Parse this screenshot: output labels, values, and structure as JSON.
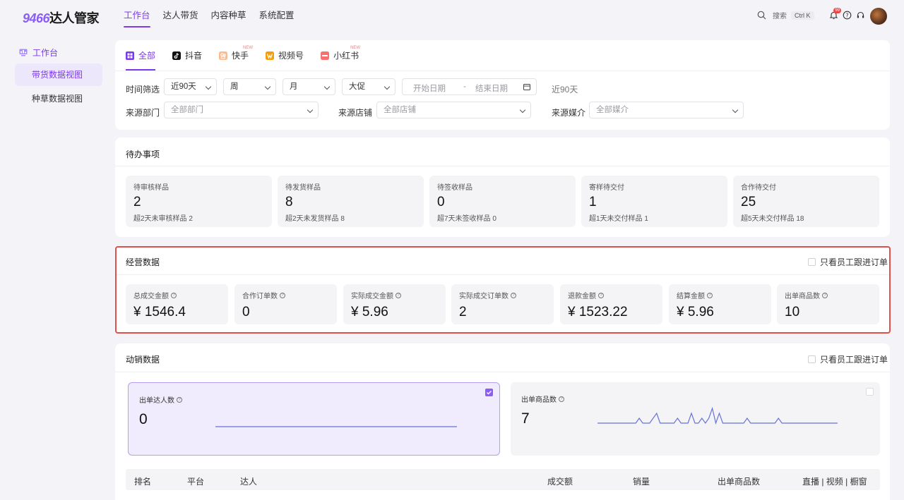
{
  "brand": {
    "num": "9466",
    "name": "达人管家"
  },
  "nav": [
    "工作台",
    "达人带货",
    "内容种草",
    "系统配置"
  ],
  "search": {
    "label": "搜索",
    "shortcut": "Ctrl K"
  },
  "notify_badge": "99",
  "sidebar": {
    "section": "工作台",
    "items": [
      "带货数据视图",
      "种草数据视图"
    ]
  },
  "platform_tabs": [
    {
      "label": "全部",
      "new": ""
    },
    {
      "label": "抖音",
      "new": ""
    },
    {
      "label": "快手",
      "new": "NEW"
    },
    {
      "label": "视频号",
      "new": ""
    },
    {
      "label": "小红书",
      "new": "NEW"
    }
  ],
  "filters": {
    "time_label": "时间筛选",
    "time_range": "近90天",
    "week": "周",
    "month": "月",
    "promo": "大促",
    "start_date": "开始日期",
    "end_date": "结束日期",
    "date_sep": "-",
    "current": "近90天",
    "dept_label": "来源部门",
    "dept_ph": "全部部门",
    "shop_label": "来源店铺",
    "shop_ph": "全部店铺",
    "media_label": "来源媒介",
    "media_ph": "全部媒介"
  },
  "pending": {
    "title": "待办事项",
    "items": [
      {
        "label": "待审核样品",
        "value": "2",
        "sub": "超2天未审核样品 2"
      },
      {
        "label": "待发货样品",
        "value": "8",
        "sub": "超2天未发货样品 8"
      },
      {
        "label": "待签收样品",
        "value": "0",
        "sub": "超7天未签收样品 0"
      },
      {
        "label": "寄样待交付",
        "value": "1",
        "sub": "超1天未交付样品 1"
      },
      {
        "label": "合作待交付",
        "value": "25",
        "sub": "超5天未交付样品 18"
      }
    ]
  },
  "operating": {
    "title": "经营数据",
    "staff_only": "只看员工跟进订单",
    "items": [
      {
        "label": "总成交金额",
        "value": "¥ 1546.4"
      },
      {
        "label": "合作订单数",
        "value": "0"
      },
      {
        "label": "实际成交金额",
        "value": "¥ 5.96"
      },
      {
        "label": "实际成交订单数",
        "value": "2"
      },
      {
        "label": "退款金额",
        "value": "¥ 1523.22"
      },
      {
        "label": "结算金额",
        "value": "¥ 5.96"
      },
      {
        "label": "出单商品数",
        "value": "10"
      }
    ]
  },
  "dynamic": {
    "title": "动销数据",
    "staff_only": "只看员工跟进订单",
    "cards": [
      {
        "label": "出单达人数",
        "value": "0",
        "checked": true
      },
      {
        "label": "出单商品数",
        "value": "7",
        "checked": false
      }
    ],
    "sparkline_talent": [
      0,
      0,
      0,
      0,
      0,
      0,
      0,
      0,
      0,
      0,
      0,
      0,
      0,
      0,
      0,
      0,
      0,
      0,
      0,
      0,
      0,
      0,
      0,
      0,
      0,
      0,
      0,
      0,
      0,
      0
    ],
    "sparkline_products": [
      0,
      0,
      0,
      0,
      0,
      0,
      0,
      0,
      0,
      0,
      0,
      0,
      1,
      0,
      0,
      0,
      1,
      2,
      0,
      0,
      0,
      0,
      0,
      1,
      0,
      0,
      0,
      2,
      0,
      0,
      1,
      0,
      1,
      3,
      0,
      2,
      0,
      0,
      0,
      0,
      0,
      0,
      0,
      1,
      0,
      0,
      0,
      0,
      0,
      0,
      0,
      0,
      1,
      0,
      0,
      0,
      0,
      0,
      0,
      0,
      0,
      0,
      0,
      0,
      0,
      0,
      0,
      0,
      0,
      0
    ],
    "line_color": "#6673d8",
    "table_headers": [
      "排名",
      "平台",
      "达人",
      "成交额",
      "销量",
      "出单商品数",
      "直播 | 视频 | 橱窗"
    ]
  },
  "colors": {
    "accent": "#7c3aed",
    "highlight": "#e0504a"
  }
}
